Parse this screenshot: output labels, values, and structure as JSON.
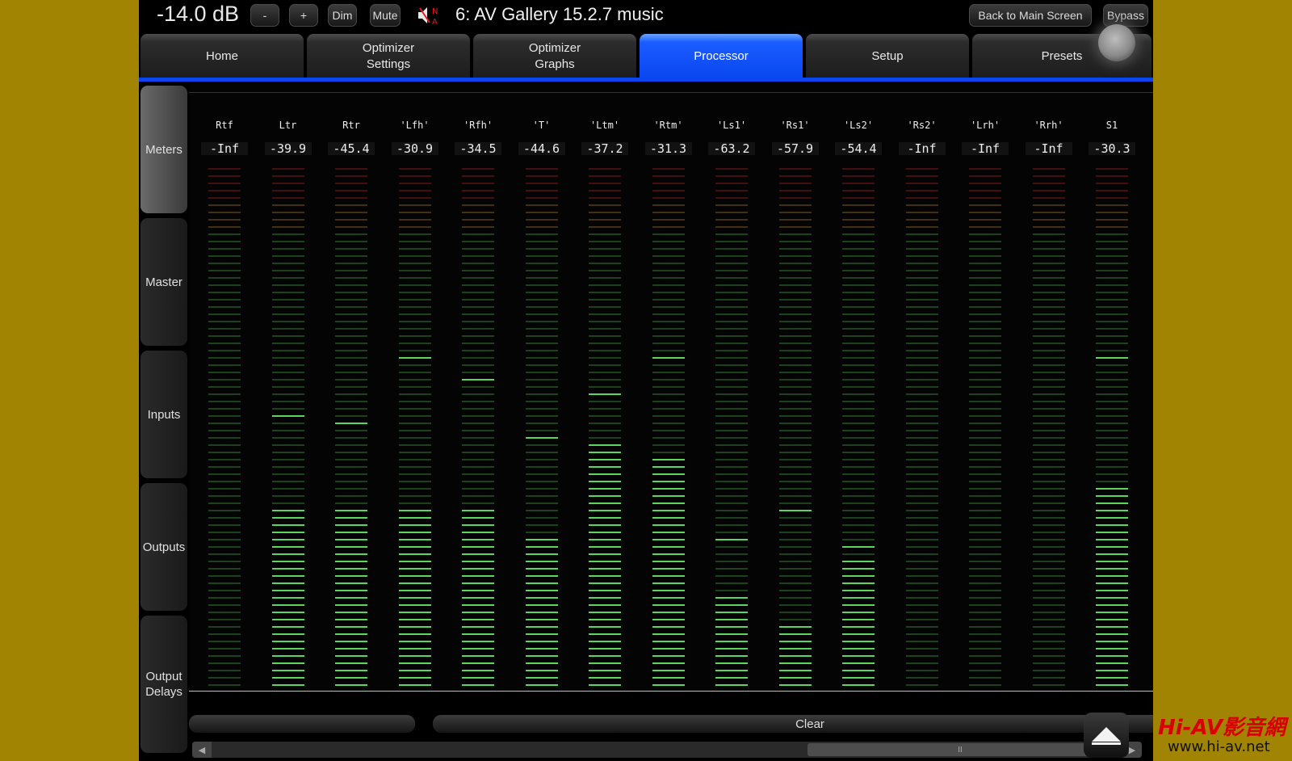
{
  "topbar": {
    "volume": "-14.0 dB",
    "minus_label": "-",
    "plus_label": "+",
    "dim_label": "Dim",
    "mute_label": "Mute",
    "speaker_badge_top": "N",
    "speaker_badge_bottom": "A",
    "preset_title": "6: AV Gallery 15.2.7 music",
    "back_label": "Back to Main Screen",
    "bypass_label": "Bypass"
  },
  "tabs": [
    {
      "label": "Home"
    },
    {
      "label": "Optimizer Settings"
    },
    {
      "label": "Optimizer Graphs"
    },
    {
      "label": "Processor"
    },
    {
      "label": "Setup"
    },
    {
      "label": "Presets"
    }
  ],
  "active_tab": "Processor",
  "sidebar": [
    {
      "label": "Meters"
    },
    {
      "label": "Master"
    },
    {
      "label": "Inputs"
    },
    {
      "label": "Outputs"
    },
    {
      "label": "Output Delays"
    }
  ],
  "active_sidebar": "Meters",
  "meter_scale": {
    "min_db": -72,
    "max_db": 0,
    "segments": 72
  },
  "meters": [
    {
      "name": "Rtf",
      "value": "-Inf",
      "peak_db": null,
      "level_db": null
    },
    {
      "name": "Ltr",
      "value": "-39.9",
      "peak_db": -35.0,
      "level_db": -48.0
    },
    {
      "name": "Rtr",
      "value": "-45.4",
      "peak_db": -36.0,
      "level_db": -48.0
    },
    {
      "name": "'Lfh'",
      "value": "-30.9",
      "peak_db": -27.0,
      "level_db": -48.0
    },
    {
      "name": "'Rfh'",
      "value": "-34.5",
      "peak_db": -30.0,
      "level_db": -48.0
    },
    {
      "name": "'T'",
      "value": "-44.6",
      "peak_db": -38.0,
      "level_db": -52.0
    },
    {
      "name": "'Ltm'",
      "value": "-37.2",
      "peak_db": -32.0,
      "level_db": -39.0
    },
    {
      "name": "'Rtm'",
      "value": "-31.3",
      "peak_db": -27.0,
      "level_db": -41.0
    },
    {
      "name": "'Ls1'",
      "value": "-63.2",
      "peak_db": -52.0,
      "level_db": -60.0
    },
    {
      "name": "'Rs1'",
      "value": "-57.9",
      "peak_db": -48.0,
      "level_db": -64.0
    },
    {
      "name": "'Ls2'",
      "value": "-54.4",
      "peak_db": -53.0,
      "level_db": -55.0
    },
    {
      "name": "'Rs2'",
      "value": "-Inf",
      "peak_db": null,
      "level_db": null
    },
    {
      "name": "'Lrh'",
      "value": "-Inf",
      "peak_db": null,
      "level_db": null
    },
    {
      "name": "'Rrh'",
      "value": "-Inf",
      "peak_db": null,
      "level_db": null
    },
    {
      "name": "S1",
      "value": "-30.3",
      "peak_db": -27.0,
      "level_db": -45.0
    }
  ],
  "colors": {
    "accent_blue": "#0a46f0",
    "meter_red": "#e63232",
    "meter_orange": "#e8a040",
    "meter_green": "#60e060",
    "background_gold": "#a08402"
  },
  "bottom": {
    "clear_label": "Clear",
    "scroll_thumb_label": "II"
  },
  "icons": {
    "speaker": "speaker-muted-icon",
    "scroll_left": "arrow-left-icon",
    "scroll_right": "arrow-right-icon",
    "up": "triangle-up-icon"
  },
  "watermark": {
    "brand": "Hi-AV影音網",
    "url": "www.hi-av.net"
  }
}
